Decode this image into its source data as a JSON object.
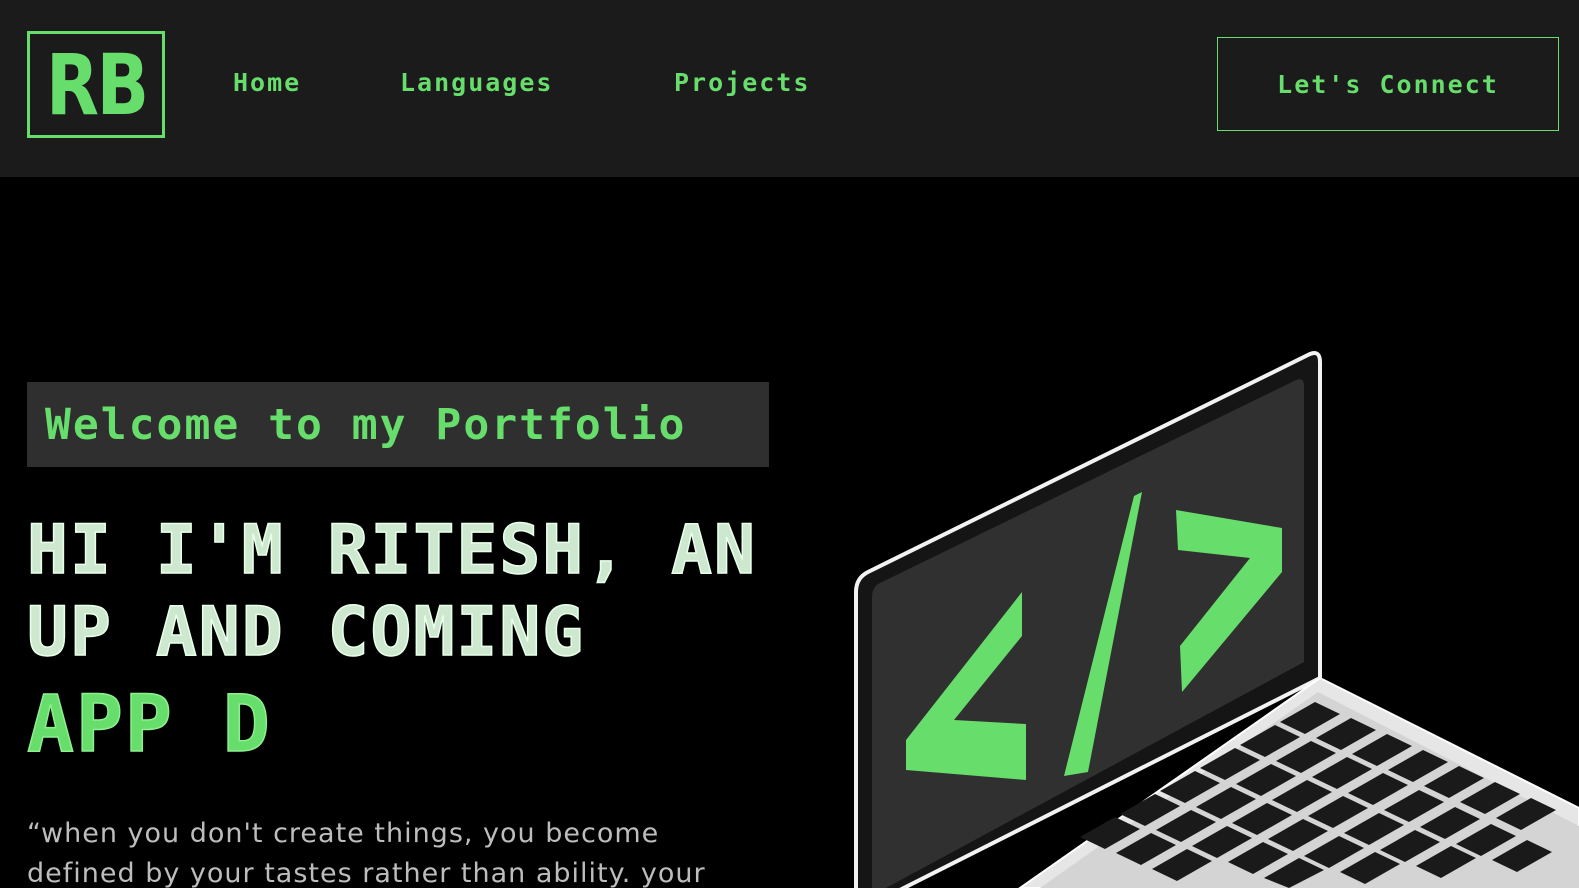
{
  "logo": {
    "text": "RB"
  },
  "nav": {
    "links": [
      {
        "label": "Home"
      },
      {
        "label": "Languages"
      },
      {
        "label": "Projects"
      }
    ],
    "connect_label": "Let's Connect"
  },
  "hero": {
    "tagline": "Welcome to my Portfolio",
    "headline_lines": [
      "HI I'M RITESH, AN",
      "UP AND COMING"
    ],
    "typed_text": "APP D",
    "quote": "“when you don't create things, you become defined by your tastes rather than ability. your"
  },
  "illustration": {
    "screen_glyph": "</>",
    "icon": "laptop-code-icon"
  },
  "colors": {
    "accent": "#67dd6b",
    "navbar_bg": "#1b1b1b",
    "page_bg": "#000000",
    "tagline_bg": "#2f2f2f",
    "headline": "#cde8cf",
    "quote": "#bdbdbd"
  }
}
